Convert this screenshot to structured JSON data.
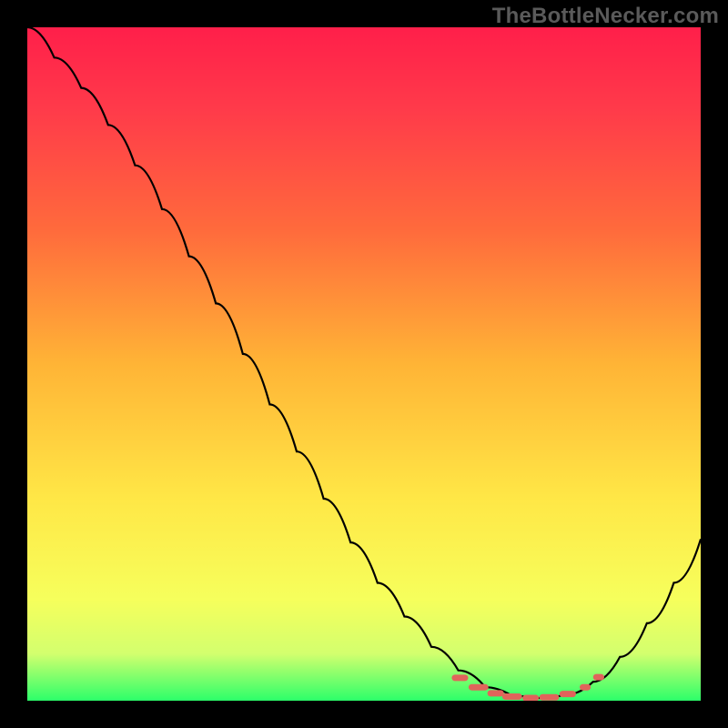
{
  "watermark": "TheBottleNecker.com",
  "chart_data": {
    "type": "line",
    "title": "",
    "xlabel": "",
    "ylabel": "",
    "xlim": [
      0,
      100
    ],
    "ylim": [
      0,
      100
    ],
    "gradient_stops": [
      {
        "offset": 0.0,
        "color": "#ff1f4a"
      },
      {
        "offset": 0.12,
        "color": "#ff3a4a"
      },
      {
        "offset": 0.3,
        "color": "#ff6a3c"
      },
      {
        "offset": 0.5,
        "color": "#ffb436"
      },
      {
        "offset": 0.7,
        "color": "#ffe746"
      },
      {
        "offset": 0.85,
        "color": "#f6ff5c"
      },
      {
        "offset": 0.93,
        "color": "#d3ff6e"
      },
      {
        "offset": 1.0,
        "color": "#2cff6a"
      }
    ],
    "curve": {
      "description": "Black bottleneck curve showing percentage bottleneck vs. configuration; steep descent from ~100 at x=0 to minimum ~0 around x≈72-82, then rises again.",
      "points": [
        {
          "x": 0.0,
          "y": 100.0
        },
        {
          "x": 4.0,
          "y": 95.5
        },
        {
          "x": 8.0,
          "y": 91.0
        },
        {
          "x": 12.0,
          "y": 85.5
        },
        {
          "x": 16.0,
          "y": 79.5
        },
        {
          "x": 20.0,
          "y": 73.0
        },
        {
          "x": 24.0,
          "y": 66.0
        },
        {
          "x": 28.0,
          "y": 59.0
        },
        {
          "x": 32.0,
          "y": 51.5
        },
        {
          "x": 36.0,
          "y": 44.0
        },
        {
          "x": 40.0,
          "y": 37.0
        },
        {
          "x": 44.0,
          "y": 30.0
        },
        {
          "x": 48.0,
          "y": 23.5
        },
        {
          "x": 52.0,
          "y": 17.5
        },
        {
          "x": 56.0,
          "y": 12.5
        },
        {
          "x": 60.0,
          "y": 8.0
        },
        {
          "x": 64.0,
          "y": 4.5
        },
        {
          "x": 68.0,
          "y": 2.0
        },
        {
          "x": 72.0,
          "y": 0.7
        },
        {
          "x": 76.0,
          "y": 0.4
        },
        {
          "x": 80.0,
          "y": 0.9
        },
        {
          "x": 84.0,
          "y": 2.8
        },
        {
          "x": 88.0,
          "y": 6.5
        },
        {
          "x": 92.0,
          "y": 11.5
        },
        {
          "x": 96.0,
          "y": 17.5
        },
        {
          "x": 100.0,
          "y": 24.0
        }
      ]
    },
    "optimal_band": {
      "description": "Salmon/coral dashed markers highlighting the near-zero bottleneck region.",
      "color": "#e0645b",
      "segments": [
        {
          "x1": 63.5,
          "x2": 65.0,
          "y": 3.4
        },
        {
          "x1": 66.0,
          "x2": 68.0,
          "y": 2.0
        },
        {
          "x1": 68.8,
          "x2": 70.3,
          "y": 1.1
        },
        {
          "x1": 71.0,
          "x2": 73.0,
          "y": 0.6
        },
        {
          "x1": 74.0,
          "x2": 75.5,
          "y": 0.4
        },
        {
          "x1": 76.5,
          "x2": 78.5,
          "y": 0.5
        },
        {
          "x1": 79.5,
          "x2": 81.0,
          "y": 1.0
        },
        {
          "x1": 82.5,
          "x2": 83.2,
          "y": 2.0
        },
        {
          "x1": 84.5,
          "x2": 85.2,
          "y": 3.5
        }
      ]
    }
  }
}
